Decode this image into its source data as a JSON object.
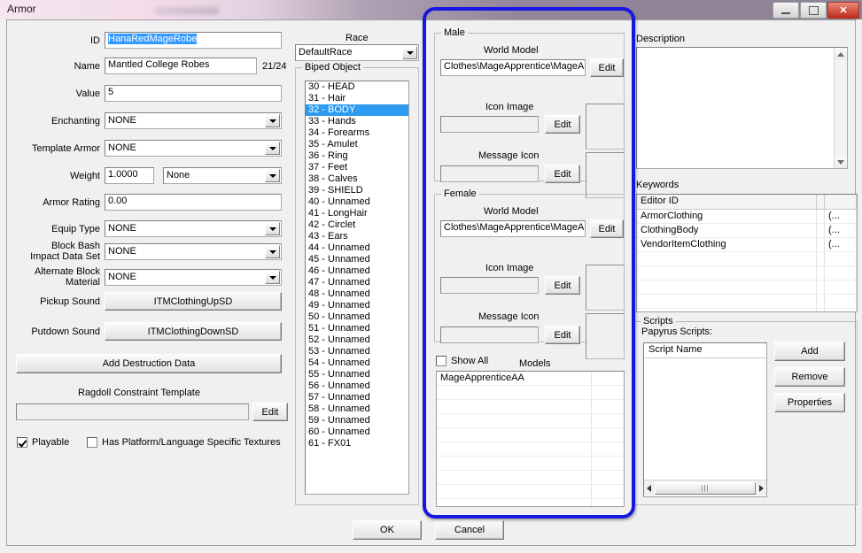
{
  "window": {
    "title": "Armor",
    "controls": {
      "minimize": "minimize-icon",
      "maximize": "maximize-icon",
      "close": "✕"
    }
  },
  "left_panel": {
    "fields": [
      {
        "label": "ID",
        "value": "HanaRedMageRobe",
        "selected": true
      },
      {
        "label": "Name",
        "value": "Mantled College Robes",
        "counter": "21/24"
      },
      {
        "label": "Value",
        "value": "5"
      }
    ],
    "combos": [
      {
        "label": "Enchanting",
        "value": "NONE"
      },
      {
        "label": "Template Armor",
        "value": "NONE"
      },
      {
        "label": "Equip Type",
        "value": "NONE"
      },
      {
        "label": "Block Bash Impact Data Set",
        "label_line1": "Block Bash",
        "label_line2": "Impact Data Set",
        "value": "NONE"
      },
      {
        "label": "Alternate Block Material",
        "label_line1": "Alternate Block",
        "label_line2": "Material",
        "value": "NONE"
      }
    ],
    "weight": {
      "label": "Weight",
      "value": "1.0000",
      "combo_value": "None"
    },
    "armor_rating": {
      "label": "Armor Rating",
      "value": "0.00"
    },
    "pickup_sound": {
      "label": "Pickup Sound",
      "value": "ITMClothingUpSD"
    },
    "putdown_sound": {
      "label": "Putdown Sound",
      "value": "ITMClothingDownSD"
    },
    "add_destruction_data": "Add Destruction Data",
    "ragdoll": {
      "label": "Ragdoll Constraint Template",
      "value": "",
      "edit": "Edit"
    },
    "checkboxes": [
      {
        "label": "Playable",
        "checked": true
      },
      {
        "label": "Has Platform/Language Specific Textures",
        "checked": false
      }
    ]
  },
  "race_panel": {
    "race_label": "Race",
    "race_value": "DefaultRace",
    "biped_group_title": "Biped Object",
    "items": [
      {
        "text": "30 - HEAD",
        "selected": false
      },
      {
        "text": "31 - Hair",
        "selected": false
      },
      {
        "text": "32 - BODY",
        "selected": true
      },
      {
        "text": "33 - Hands",
        "selected": false
      },
      {
        "text": "34 - Forearms",
        "selected": false
      },
      {
        "text": "35 - Amulet",
        "selected": false
      },
      {
        "text": "36 - Ring",
        "selected": false
      },
      {
        "text": "37 - Feet",
        "selected": false
      },
      {
        "text": "38 - Calves",
        "selected": false
      },
      {
        "text": "39 - SHIELD",
        "selected": false
      },
      {
        "text": "40 - Unnamed",
        "selected": false
      },
      {
        "text": "41 - LongHair",
        "selected": false
      },
      {
        "text": "42 - Circlet",
        "selected": false
      },
      {
        "text": "43 - Ears",
        "selected": false
      },
      {
        "text": "44 - Unnamed",
        "selected": false
      },
      {
        "text": "45 - Unnamed",
        "selected": false
      },
      {
        "text": "46 - Unnamed",
        "selected": false
      },
      {
        "text": "47 - Unnamed",
        "selected": false
      },
      {
        "text": "48 - Unnamed",
        "selected": false
      },
      {
        "text": "49 - Unnamed",
        "selected": false
      },
      {
        "text": "50 - Unnamed",
        "selected": false
      },
      {
        "text": "51 - Unnamed",
        "selected": false
      },
      {
        "text": "52 - Unnamed",
        "selected": false
      },
      {
        "text": "53 - Unnamed",
        "selected": false
      },
      {
        "text": "54 - Unnamed",
        "selected": false
      },
      {
        "text": "55 - Unnamed",
        "selected": false
      },
      {
        "text": "56 - Unnamed",
        "selected": false
      },
      {
        "text": "57 - Unnamed",
        "selected": false
      },
      {
        "text": "58 - Unnamed",
        "selected": false
      },
      {
        "text": "59 - Unnamed",
        "selected": false
      },
      {
        "text": "60 - Unnamed",
        "selected": false
      },
      {
        "text": "61 - FX01",
        "selected": false
      }
    ]
  },
  "model_panel": {
    "male": {
      "title": "Male",
      "world_model_label": "World Model",
      "world_model_value": "Clothes\\MageApprentice\\MageA",
      "world_model_edit": "Edit",
      "icon_image_label": "Icon Image",
      "icon_image_value": "",
      "icon_image_edit": "Edit",
      "message_icon_label": "Message Icon",
      "message_icon_value": "",
      "message_icon_edit": "Edit"
    },
    "female": {
      "title": "Female",
      "world_model_label": "World Model",
      "world_model_value": "Clothes\\MageApprentice\\MageA",
      "world_model_edit": "Edit",
      "icon_image_label": "Icon Image",
      "icon_image_value": "",
      "icon_image_edit": "Edit",
      "message_icon_label": "Message Icon",
      "message_icon_value": "",
      "message_icon_edit": "Edit"
    },
    "show_all": {
      "label": "Show All",
      "checked": false
    },
    "models_label": "Models",
    "models": [
      "MageApprenticeAA"
    ]
  },
  "right_panel": {
    "description_label": "Description",
    "description_value": "",
    "keywords_label": "Keywords",
    "keywords_columns": [
      "Editor ID",
      ""
    ],
    "keywords": [
      {
        "editor_id": "ArmorClothing",
        "extra": "(..."
      },
      {
        "editor_id": "ClothingBody",
        "extra": "(..."
      },
      {
        "editor_id": "VendorItemClothing",
        "extra": "(..."
      }
    ],
    "scripts_group": "Scripts",
    "papyrus_label": "Papyrus Scripts:",
    "script_column": "Script Name",
    "scripts": [],
    "buttons": {
      "add": "Add",
      "remove": "Remove",
      "properties": "Properties"
    }
  },
  "footer": {
    "ok": "OK",
    "cancel": "Cancel"
  },
  "annotation": {
    "color": "#1717e0",
    "shape": "rounded-rectangle-highlight"
  }
}
